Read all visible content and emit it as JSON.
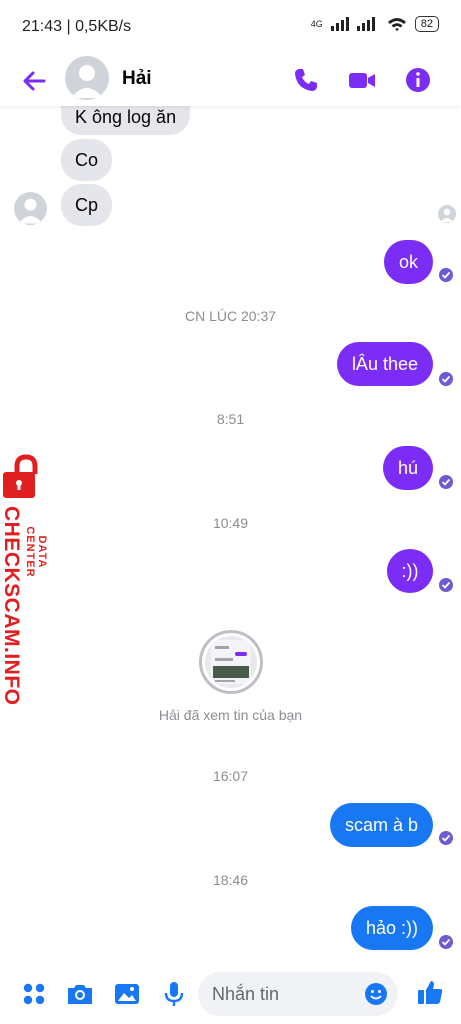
{
  "status_bar": {
    "time": "21:43 | 0,5KB/s",
    "network": "4G",
    "battery": "82"
  },
  "header": {
    "contact_name": "Hải"
  },
  "messages": {
    "in_1": "K ông log ăn",
    "in_2": "Co",
    "in_3": "Cp",
    "out_1": "ok",
    "ts_1": "CN LÚC 20:37",
    "out_2": "lÂu thee",
    "ts_2": "8:51",
    "out_3": "hú",
    "ts_3": "10:49",
    "out_4": ":))",
    "seen_text": "Hải đã xem tin của bạn",
    "ts_4": "16:07",
    "out_5": "scam à b",
    "ts_5": "18:46",
    "out_6": "hảo :))"
  },
  "watermark": {
    "title": "CHECKSCAM.INFO",
    "subtitle": "DATA CENTER"
  },
  "composer": {
    "placeholder": "Nhắn tin"
  },
  "colors": {
    "accent": "#7b2cf5",
    "blue_bubble": "#1877f2",
    "incoming": "#e4e6eb"
  },
  "icons": [
    "back-arrow-icon",
    "phone-icon",
    "video-icon",
    "info-icon",
    "apps-icon",
    "camera-icon",
    "image-icon",
    "mic-icon",
    "emoji-icon",
    "like-icon"
  ]
}
